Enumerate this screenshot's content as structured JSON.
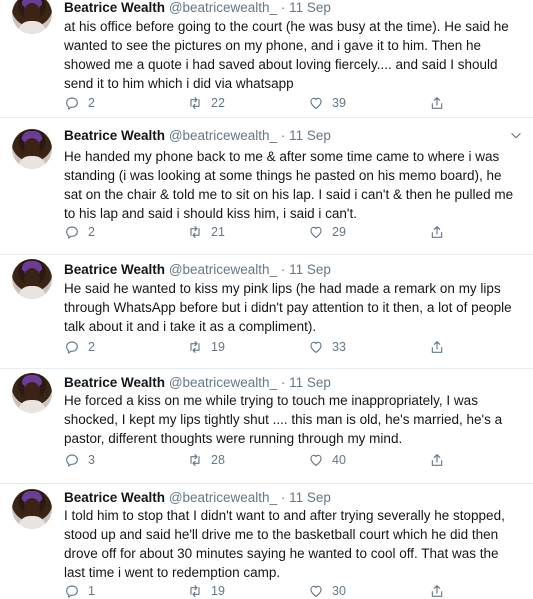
{
  "tweets": [
    {
      "name": "Beatrice Wealth",
      "handle": "@beatricewealth_",
      "dot": "·",
      "time": "11 Sep",
      "text": "at his office before going to the court (he was busy at the time). He said he wanted to see the pictures on my phone, and i gave it to him. Then he showed me a quote i had saved about loving fiercely.... and said I should send it to him which i did via whatsapp",
      "replies": "2",
      "retweets": "22",
      "likes": "39"
    },
    {
      "name": "Beatrice Wealth",
      "handle": "@beatricewealth_",
      "dot": "·",
      "time": "11 Sep",
      "text": "He handed my phone back to me & after some time came to where i was standing (i was looking at some things he pasted on his memo board), he sat on the chair & told me to sit on his lap. I said i can't & then he pulled me to his lap and said i should kiss him, i said i can't.",
      "replies": "2",
      "retweets": "21",
      "likes": "29"
    },
    {
      "name": "Beatrice Wealth",
      "handle": "@beatricewealth_",
      "dot": "·",
      "time": "11 Sep",
      "text": "He said he wanted to kiss my pink lips (he had made a remark on my lips through WhatsApp before but i didn't pay attention to it then, a lot of people talk about it and i take it as a compliment).",
      "replies": "2",
      "retweets": "19",
      "likes": "33"
    },
    {
      "name": "Beatrice Wealth",
      "handle": "@beatricewealth_",
      "dot": "·",
      "time": "11 Sep",
      "text": "He forced a kiss on me while trying to touch me inappropriately, I was shocked, I kept my lips tightly shut .... this man is old, he's married, he's a pastor, different thoughts were running through my mind.",
      "replies": "3",
      "retweets": "28",
      "likes": "40"
    },
    {
      "name": "Beatrice Wealth",
      "handle": "@beatricewealth_",
      "dot": "·",
      "time": "11 Sep",
      "text": "I told him to stop that I didn't want to and after trying severally he stopped, stood up and said he'll drive me to the basketball court which he did then drove off for about 30 minutes saying he wanted to cool off. That was the last time i went to redemption camp.",
      "replies": "1",
      "retweets": "19",
      "likes": "30"
    }
  ],
  "icons": {
    "reply": "reply-icon",
    "retweet": "retweet-icon",
    "like": "heart-icon",
    "share": "share-icon",
    "caret": "chevron-down-icon"
  },
  "colors": {
    "text": "#14171a",
    "muted": "#657786",
    "divider": "#e6ecf0"
  }
}
